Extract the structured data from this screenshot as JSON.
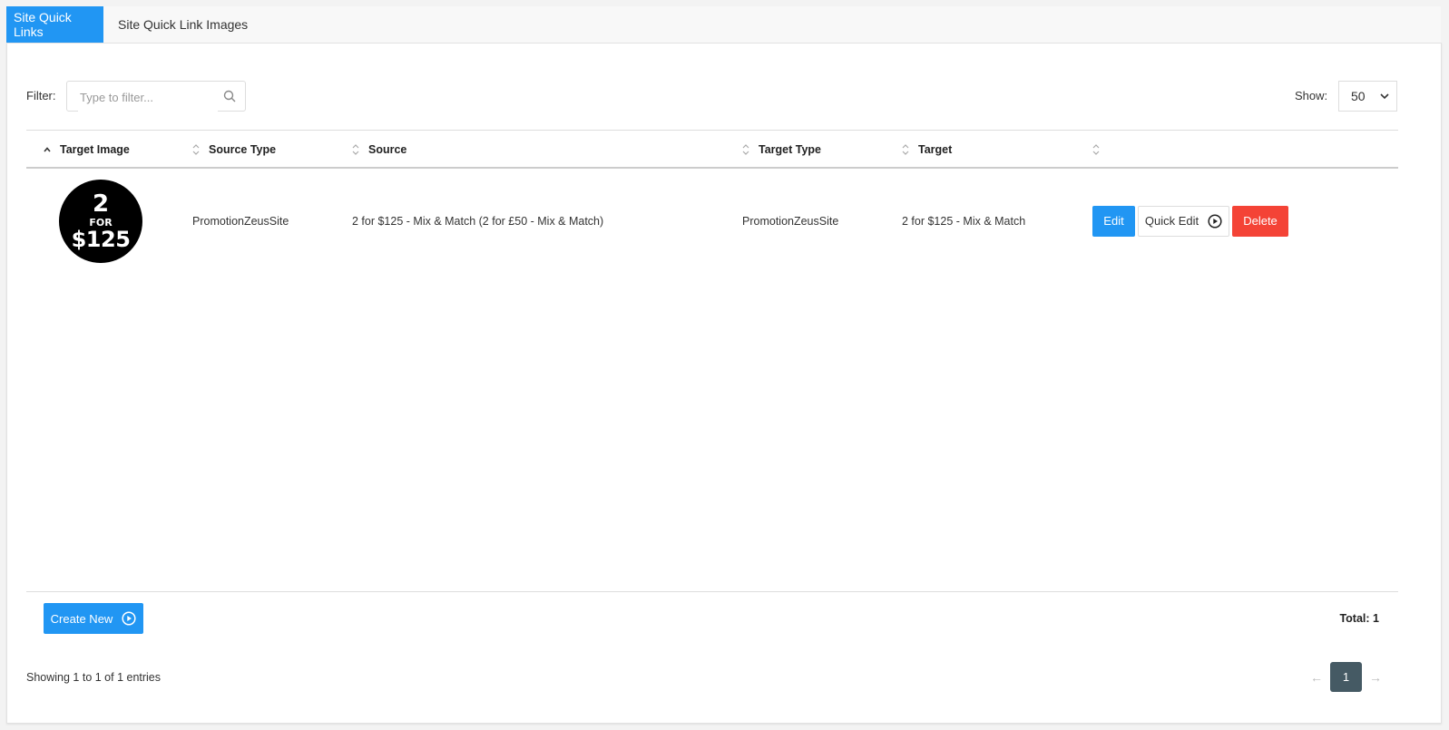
{
  "tabs": [
    {
      "label": "Site Quick Links",
      "active": true
    },
    {
      "label": "Site Quick Link Images",
      "active": false
    }
  ],
  "filter": {
    "label": "Filter:",
    "placeholder": "Type to filter...",
    "value": ""
  },
  "show": {
    "label": "Show:",
    "value": "50"
  },
  "table": {
    "columns": [
      {
        "label": "Target Image",
        "sort": "asc"
      },
      {
        "label": "Source Type",
        "sort": "none"
      },
      {
        "label": "Source",
        "sort": "none"
      },
      {
        "label": "Target Type",
        "sort": "none"
      },
      {
        "label": "Target",
        "sort": "none"
      },
      {
        "label": "",
        "sort": "none"
      }
    ],
    "rows": [
      {
        "image": {
          "line1": "2",
          "line2": "FOR",
          "line3": "$125"
        },
        "source_type": "PromotionZeusSite",
        "source": "2 for $125 - Mix & Match (2 for £50 - Mix & Match)",
        "target_type": "PromotionZeusSite",
        "target": "2 for $125 - Mix & Match",
        "actions": {
          "edit": "Edit",
          "quick_edit": "Quick Edit",
          "delete": "Delete"
        }
      }
    ]
  },
  "footer": {
    "create_label": "Create New",
    "total_label": "Total: 1",
    "showing_text": "Showing 1 to 1 of 1 entries",
    "pagination": {
      "prev": "←",
      "current": "1",
      "next": "→"
    }
  },
  "colors": {
    "primary": "#2196f3",
    "danger": "#f44336",
    "page_active": "#455a64"
  }
}
